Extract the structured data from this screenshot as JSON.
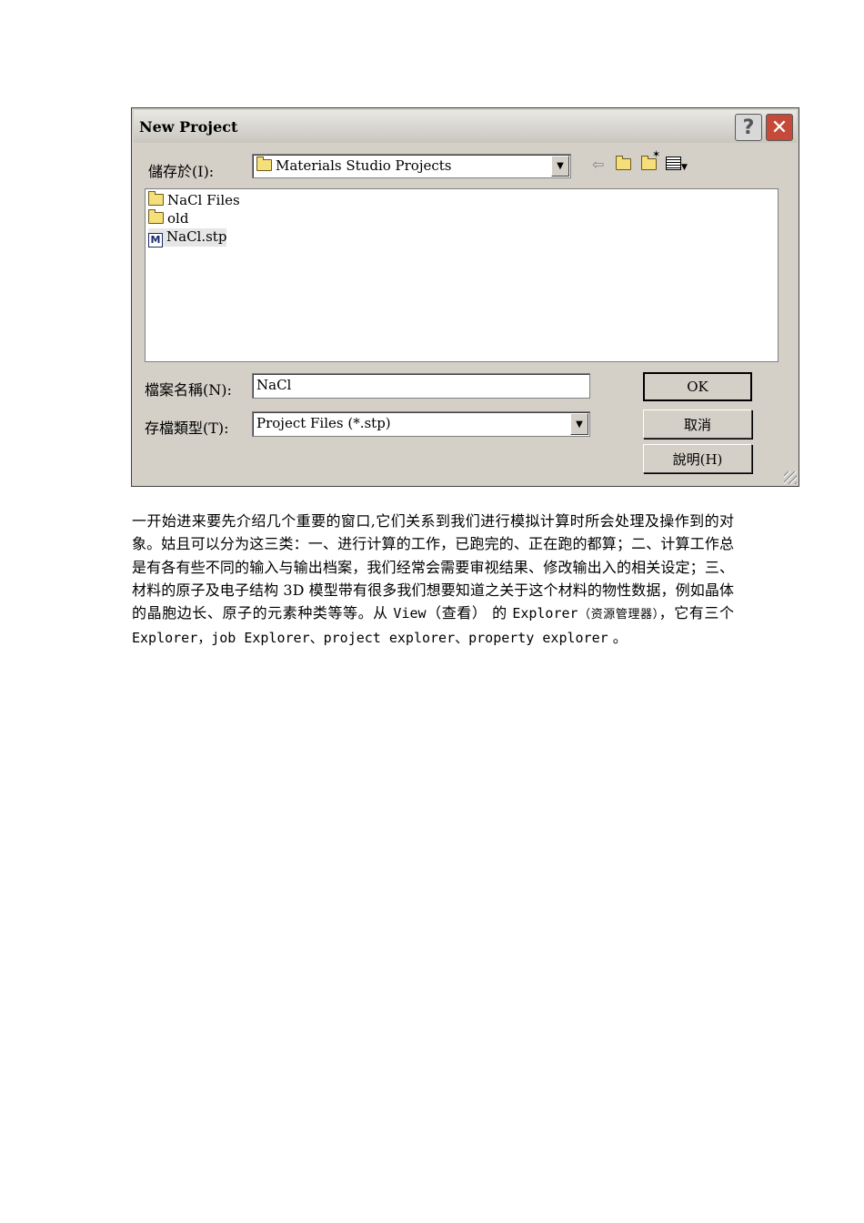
{
  "dialog": {
    "title": "New Project",
    "help_button": "?",
    "close_button": "✕",
    "save_in_label": "儲存於(I):",
    "save_in_value": "Materials Studio Projects",
    "toolbar": {
      "back_icon": "back-arrow-icon",
      "up_icon": "up-folder-icon",
      "new_folder_icon": "new-folder-icon",
      "view_menu_icon": "view-menu-icon"
    },
    "files": [
      {
        "name": "NaCl Files",
        "type": "folder"
      },
      {
        "name": "old",
        "type": "folder"
      },
      {
        "name": "NaCl.stp",
        "type": "project",
        "icon_letter": "M",
        "selected": true
      }
    ],
    "filename_label": "檔案名稱(N):",
    "filename_value": "NaCl",
    "filetype_label": "存檔類型(T):",
    "filetype_value": "Project Files (*.stp)",
    "ok_button": "OK",
    "cancel_button": "取消",
    "help_text_button": "說明(H)"
  },
  "paragraph": {
    "s1": "一开始进来要先介绍几个重要的窗口,它们关系到我们进行模拟计算时所会处理及操作到的对象。姑且可以分为这三类：一、进行计算的工作，已跑完的、正在跑的都算；二、计算工作总是有各有些不同的输入与输出档案，我们经常会需要审视结果、修改输出入的相关设定；三、材料的原子及电子结构 3D 模型带有很多我们想要知道之关于这个材料的物性数据，例如晶体的晶胞边长、原子的元素种类等等。从 ",
    "s2": "View",
    "s3": "（查看） 的 ",
    "s4": "Explorer",
    "s5": "（资源管理器）",
    "s6": "，它有三个 ",
    "s7": "Explorer，job Explorer、project explorer、property explorer",
    "s8": " 。"
  }
}
